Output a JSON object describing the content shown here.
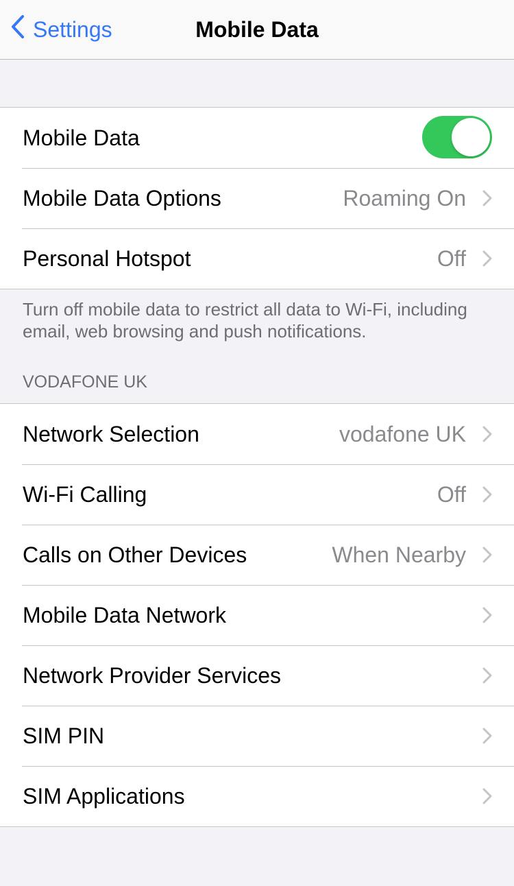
{
  "nav": {
    "back_label": "Settings",
    "title": "Mobile Data"
  },
  "group1": {
    "rows": [
      {
        "label": "Mobile Data",
        "toggle": true
      },
      {
        "label": "Mobile Data Options",
        "value": "Roaming On"
      },
      {
        "label": "Personal Hotspot",
        "value": "Off"
      }
    ],
    "footer": "Turn off mobile data to restrict all data to Wi-Fi, including email, web browsing and push notifications."
  },
  "group2": {
    "header": "VODAFONE UK",
    "rows": [
      {
        "label": "Network Selection",
        "value": "vodafone UK"
      },
      {
        "label": "Wi-Fi Calling",
        "value": "Off"
      },
      {
        "label": "Calls on Other Devices",
        "value": "When Nearby"
      },
      {
        "label": "Mobile Data Network",
        "value": ""
      },
      {
        "label": "Network Provider Services",
        "value": ""
      },
      {
        "label": "SIM PIN",
        "value": ""
      },
      {
        "label": "SIM Applications",
        "value": ""
      }
    ]
  },
  "colors": {
    "accent": "#3478f6",
    "toggle_on": "#34c759",
    "secondary_text": "#8a8a8e",
    "background": "#f2f2f7"
  }
}
